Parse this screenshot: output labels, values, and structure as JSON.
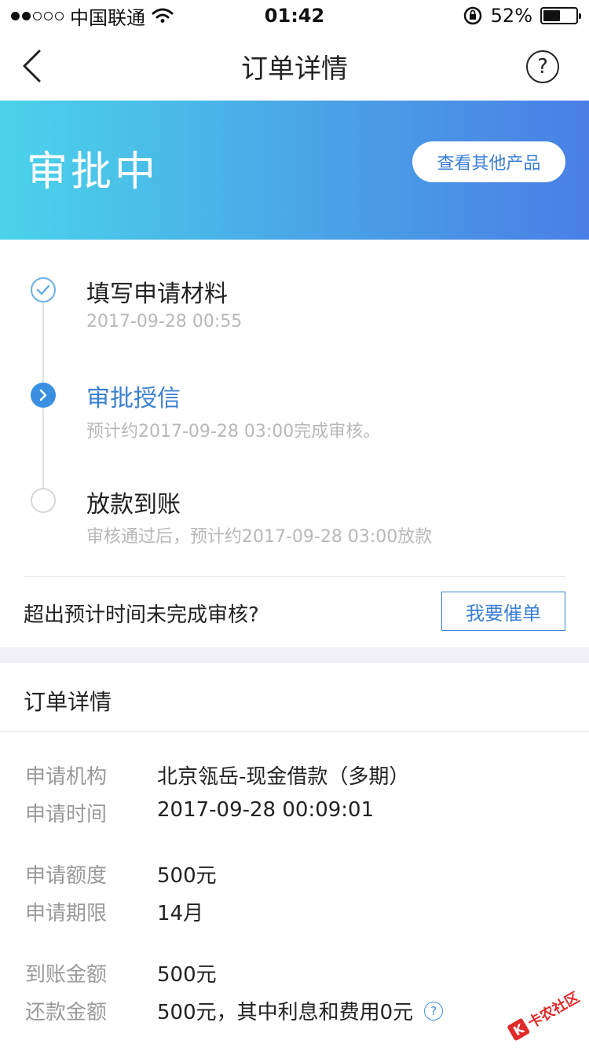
{
  "status_bar": {
    "carrier": "中国联通",
    "time": "01:42",
    "battery": "52%",
    "battery_level": 0.52,
    "signal_bars": 2,
    "signal_total": 5
  },
  "nav": {
    "title": "订单详情",
    "help_glyph": "?"
  },
  "banner": {
    "status": "审批中",
    "button": "查看其他产品"
  },
  "timeline": [
    {
      "title": "填写申请材料",
      "sub": "2017-09-28 00:55",
      "state": "done"
    },
    {
      "title": "审批授信",
      "sub": "预计约2017-09-28 03:00完成审核。",
      "state": "active"
    },
    {
      "title": "放款到账",
      "sub": "审核通过后，预计约2017-09-28 03:00放款",
      "state": "pending"
    }
  ],
  "urge": {
    "text": "超出预计时间未完成审核?",
    "button": "我要催单"
  },
  "detail": {
    "title": "订单详情",
    "rows": [
      {
        "label": "申请机构",
        "value": "北京瓴岳-现金借款（多期）"
      },
      {
        "label": "申请时间",
        "value": "2017-09-28 00:09:01"
      },
      {
        "label": "申请额度",
        "value": "500元"
      },
      {
        "label": "申请期限",
        "value": "14月"
      },
      {
        "label": "到账金额",
        "value": "500元"
      },
      {
        "label": "还款金额",
        "value": "500元，其中利息和费用0元",
        "help": "?"
      }
    ]
  },
  "watermark": {
    "text": "卡农社区",
    "mark": "K"
  },
  "colors": {
    "accent": "#3b7fd0",
    "banner_start": "#4bd3ea",
    "banner_end": "#4a7fe5"
  },
  "icons": [
    "back-chevron-icon",
    "help-circle-icon",
    "wifi-icon",
    "orientation-lock-icon",
    "battery-icon",
    "check-icon",
    "chevron-right-icon"
  ]
}
